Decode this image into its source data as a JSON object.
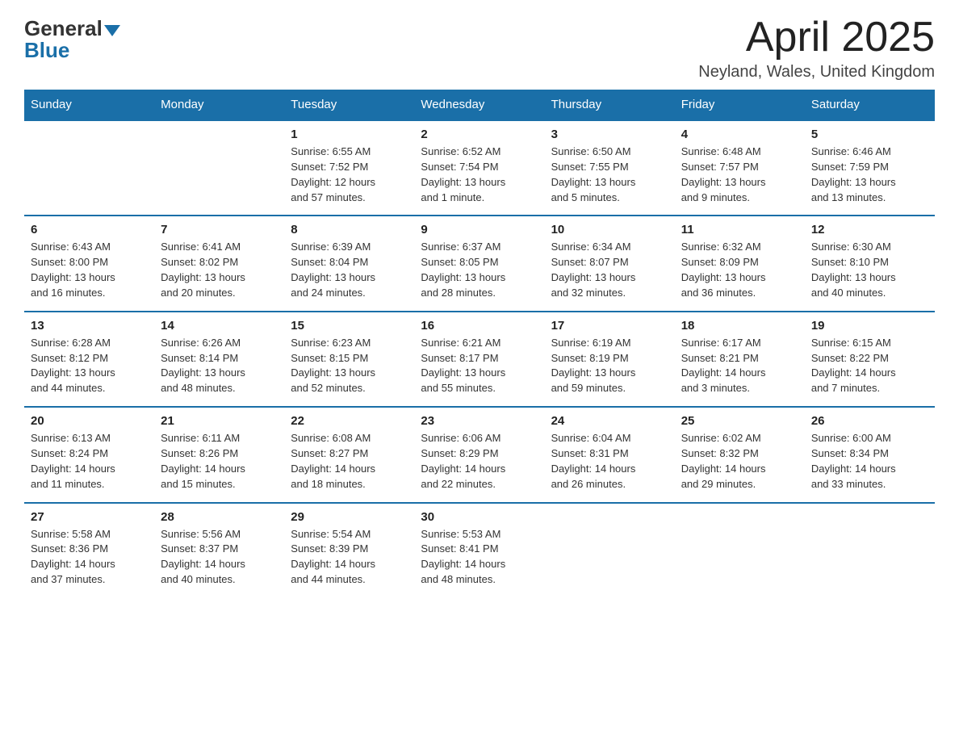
{
  "header": {
    "logo_general": "General",
    "logo_blue": "Blue",
    "title": "April 2025",
    "subtitle": "Neyland, Wales, United Kingdom"
  },
  "weekdays": [
    "Sunday",
    "Monday",
    "Tuesday",
    "Wednesday",
    "Thursday",
    "Friday",
    "Saturday"
  ],
  "weeks": [
    [
      {
        "day": "",
        "info": ""
      },
      {
        "day": "",
        "info": ""
      },
      {
        "day": "1",
        "info": "Sunrise: 6:55 AM\nSunset: 7:52 PM\nDaylight: 12 hours\nand 57 minutes."
      },
      {
        "day": "2",
        "info": "Sunrise: 6:52 AM\nSunset: 7:54 PM\nDaylight: 13 hours\nand 1 minute."
      },
      {
        "day": "3",
        "info": "Sunrise: 6:50 AM\nSunset: 7:55 PM\nDaylight: 13 hours\nand 5 minutes."
      },
      {
        "day": "4",
        "info": "Sunrise: 6:48 AM\nSunset: 7:57 PM\nDaylight: 13 hours\nand 9 minutes."
      },
      {
        "day": "5",
        "info": "Sunrise: 6:46 AM\nSunset: 7:59 PM\nDaylight: 13 hours\nand 13 minutes."
      }
    ],
    [
      {
        "day": "6",
        "info": "Sunrise: 6:43 AM\nSunset: 8:00 PM\nDaylight: 13 hours\nand 16 minutes."
      },
      {
        "day": "7",
        "info": "Sunrise: 6:41 AM\nSunset: 8:02 PM\nDaylight: 13 hours\nand 20 minutes."
      },
      {
        "day": "8",
        "info": "Sunrise: 6:39 AM\nSunset: 8:04 PM\nDaylight: 13 hours\nand 24 minutes."
      },
      {
        "day": "9",
        "info": "Sunrise: 6:37 AM\nSunset: 8:05 PM\nDaylight: 13 hours\nand 28 minutes."
      },
      {
        "day": "10",
        "info": "Sunrise: 6:34 AM\nSunset: 8:07 PM\nDaylight: 13 hours\nand 32 minutes."
      },
      {
        "day": "11",
        "info": "Sunrise: 6:32 AM\nSunset: 8:09 PM\nDaylight: 13 hours\nand 36 minutes."
      },
      {
        "day": "12",
        "info": "Sunrise: 6:30 AM\nSunset: 8:10 PM\nDaylight: 13 hours\nand 40 minutes."
      }
    ],
    [
      {
        "day": "13",
        "info": "Sunrise: 6:28 AM\nSunset: 8:12 PM\nDaylight: 13 hours\nand 44 minutes."
      },
      {
        "day": "14",
        "info": "Sunrise: 6:26 AM\nSunset: 8:14 PM\nDaylight: 13 hours\nand 48 minutes."
      },
      {
        "day": "15",
        "info": "Sunrise: 6:23 AM\nSunset: 8:15 PM\nDaylight: 13 hours\nand 52 minutes."
      },
      {
        "day": "16",
        "info": "Sunrise: 6:21 AM\nSunset: 8:17 PM\nDaylight: 13 hours\nand 55 minutes."
      },
      {
        "day": "17",
        "info": "Sunrise: 6:19 AM\nSunset: 8:19 PM\nDaylight: 13 hours\nand 59 minutes."
      },
      {
        "day": "18",
        "info": "Sunrise: 6:17 AM\nSunset: 8:21 PM\nDaylight: 14 hours\nand 3 minutes."
      },
      {
        "day": "19",
        "info": "Sunrise: 6:15 AM\nSunset: 8:22 PM\nDaylight: 14 hours\nand 7 minutes."
      }
    ],
    [
      {
        "day": "20",
        "info": "Sunrise: 6:13 AM\nSunset: 8:24 PM\nDaylight: 14 hours\nand 11 minutes."
      },
      {
        "day": "21",
        "info": "Sunrise: 6:11 AM\nSunset: 8:26 PM\nDaylight: 14 hours\nand 15 minutes."
      },
      {
        "day": "22",
        "info": "Sunrise: 6:08 AM\nSunset: 8:27 PM\nDaylight: 14 hours\nand 18 minutes."
      },
      {
        "day": "23",
        "info": "Sunrise: 6:06 AM\nSunset: 8:29 PM\nDaylight: 14 hours\nand 22 minutes."
      },
      {
        "day": "24",
        "info": "Sunrise: 6:04 AM\nSunset: 8:31 PM\nDaylight: 14 hours\nand 26 minutes."
      },
      {
        "day": "25",
        "info": "Sunrise: 6:02 AM\nSunset: 8:32 PM\nDaylight: 14 hours\nand 29 minutes."
      },
      {
        "day": "26",
        "info": "Sunrise: 6:00 AM\nSunset: 8:34 PM\nDaylight: 14 hours\nand 33 minutes."
      }
    ],
    [
      {
        "day": "27",
        "info": "Sunrise: 5:58 AM\nSunset: 8:36 PM\nDaylight: 14 hours\nand 37 minutes."
      },
      {
        "day": "28",
        "info": "Sunrise: 5:56 AM\nSunset: 8:37 PM\nDaylight: 14 hours\nand 40 minutes."
      },
      {
        "day": "29",
        "info": "Sunrise: 5:54 AM\nSunset: 8:39 PM\nDaylight: 14 hours\nand 44 minutes."
      },
      {
        "day": "30",
        "info": "Sunrise: 5:53 AM\nSunset: 8:41 PM\nDaylight: 14 hours\nand 48 minutes."
      },
      {
        "day": "",
        "info": ""
      },
      {
        "day": "",
        "info": ""
      },
      {
        "day": "",
        "info": ""
      }
    ]
  ]
}
